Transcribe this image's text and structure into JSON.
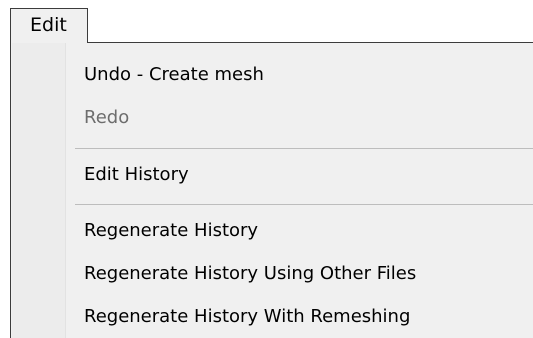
{
  "menubar": {
    "edit_label": "Edit"
  },
  "menu": {
    "items": [
      {
        "label": "Undo - Create mesh",
        "enabled": true
      },
      {
        "label": "Redo",
        "enabled": false
      },
      {
        "label": "Edit History",
        "enabled": true
      },
      {
        "label": "Regenerate History",
        "enabled": true
      },
      {
        "label": "Regenerate History Using Other Files",
        "enabled": true
      },
      {
        "label": "Regenerate History With Remeshing",
        "enabled": true
      }
    ]
  }
}
